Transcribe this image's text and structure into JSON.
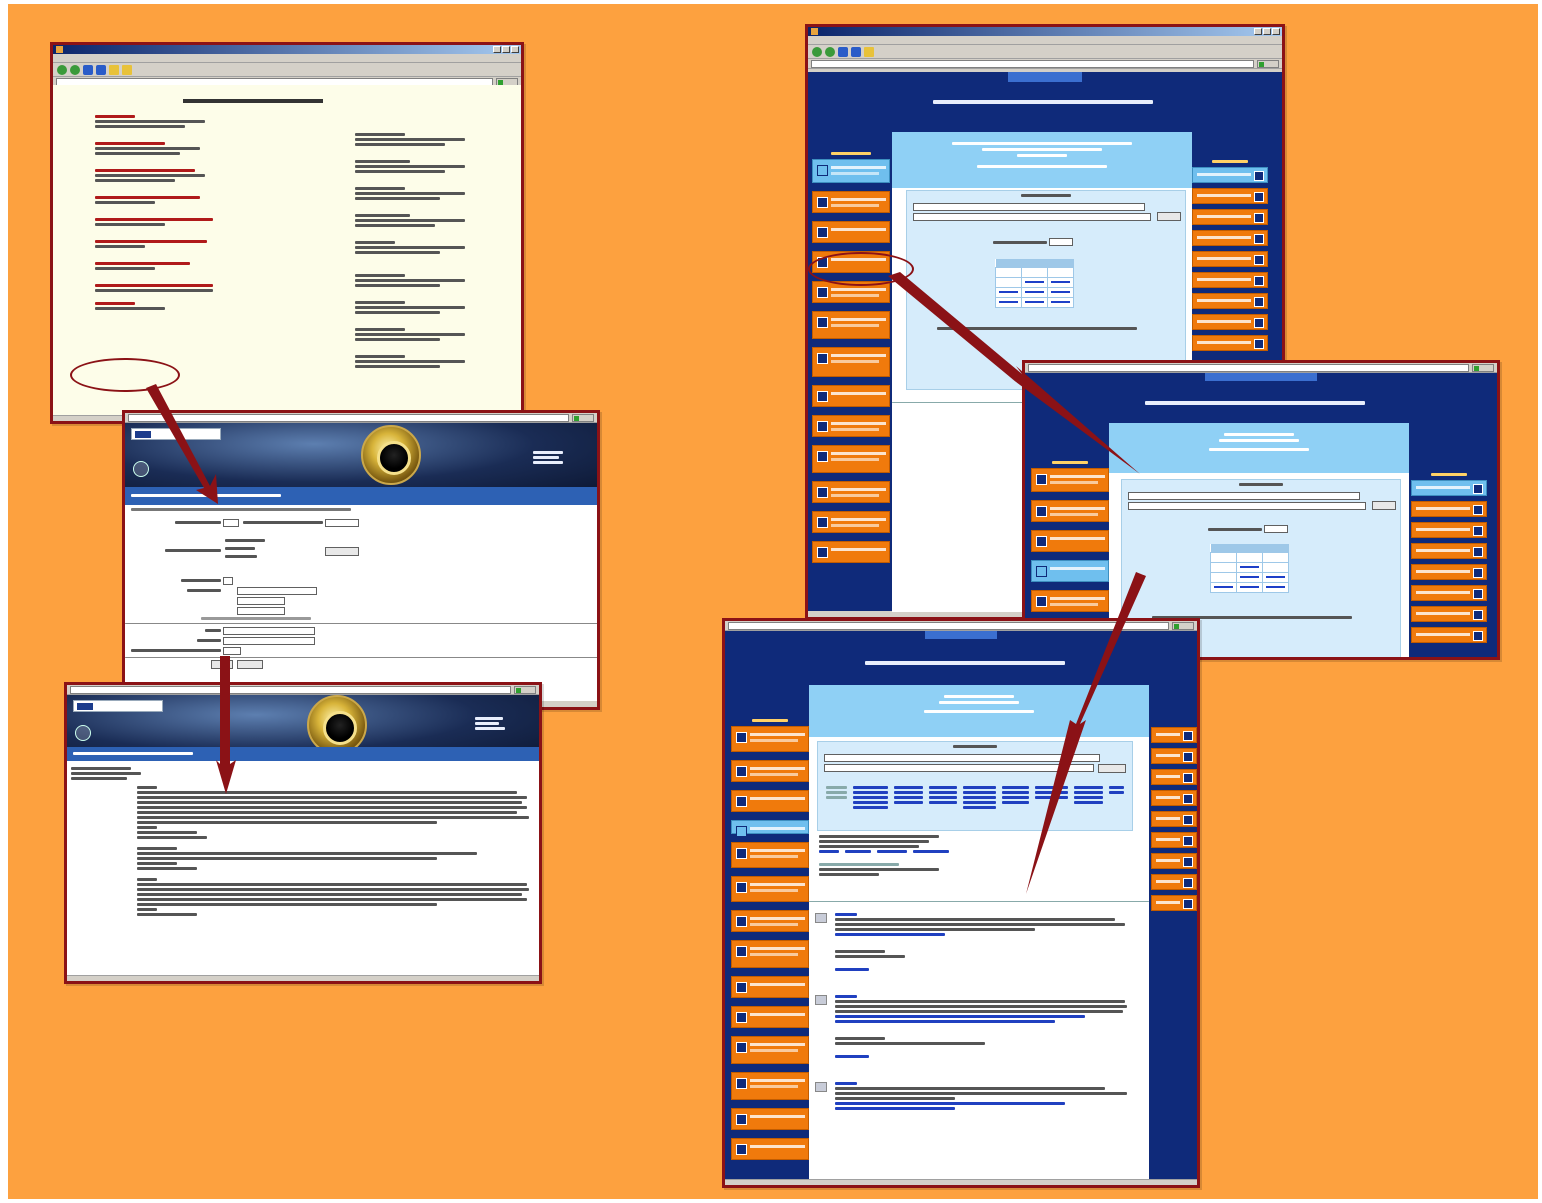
{
  "windows": [],
  "colors": {
    "background": "#fda13f",
    "frame_border": "#8b1216",
    "arrow": "#8b1216",
    "site_navy": "#0f2a7a",
    "site_orange_menu": "#f07a0c",
    "site_light_blue": "#8fd0f5"
  },
  "icons": [
    "browser-window-icon",
    "back-icon",
    "forward-icon",
    "stop-icon",
    "refresh-icon",
    "home-icon",
    "go-icon",
    "library-emblem-icon",
    "menu-square-icon"
  ]
}
